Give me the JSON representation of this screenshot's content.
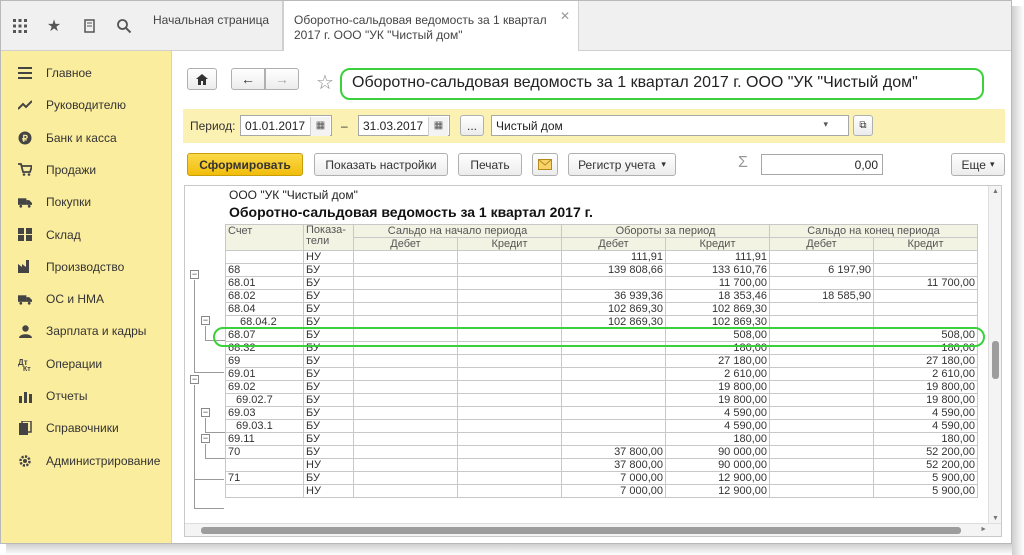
{
  "tabs": [
    {
      "label": "Начальная страница"
    },
    {
      "label": "Оборотно-сальдовая ведомость за 1 квартал 2017 г. ООО \"УК \"Чистый дом\""
    }
  ],
  "sidebar": {
    "items": [
      {
        "label": "Главное",
        "icon": "menu-icon"
      },
      {
        "label": "Руководителю",
        "icon": "trend-icon"
      },
      {
        "label": "Банк и касса",
        "icon": "coin-icon"
      },
      {
        "label": "Продажи",
        "icon": "cart-icon"
      },
      {
        "label": "Покупки",
        "icon": "truck-icon"
      },
      {
        "label": "Склад",
        "icon": "warehouse-icon"
      },
      {
        "label": "Производство",
        "icon": "factory-icon"
      },
      {
        "label": "ОС и НМА",
        "icon": "truck-icon"
      },
      {
        "label": "Зарплата и кадры",
        "icon": "person-icon"
      },
      {
        "label": "Операции",
        "icon": "operations-icon"
      },
      {
        "label": "Отчеты",
        "icon": "chart-icon"
      },
      {
        "label": "Справочники",
        "icon": "books-icon"
      },
      {
        "label": "Администрирование",
        "icon": "gear-icon"
      }
    ]
  },
  "header": {
    "title": "Оборотно-сальдовая ведомость за 1 квартал 2017 г. ООО \"УК \"Чистый дом\""
  },
  "period": {
    "label": "Период:",
    "from": "01.01.2017",
    "dash": "–",
    "to": "31.03.2017",
    "ellipsis": "...",
    "org": "Чистый дом"
  },
  "toolbar": {
    "generate": "Сформировать",
    "settings": "Показать настройки",
    "print": "Печать",
    "register": "Регистр учета",
    "sum_symbol": "Σ",
    "sum_value": "0,00",
    "more": "Еще"
  },
  "report": {
    "company": "ООО \"УК \"Чистый дом\"",
    "title": "Оборотно-сальдовая ведомость за 1 квартал 2017 г.",
    "headers": {
      "account": "Счет",
      "indicator_line1": "Показа-",
      "indicator_line2": "тели",
      "opening": "Сальдо на начало периода",
      "turnover": "Обороты за период",
      "closing": "Сальдо на конец периода",
      "debit": "Дебет",
      "credit": "Кредит"
    },
    "rows": [
      {
        "account": "",
        "ind": "НУ",
        "od": "",
        "oc": "",
        "td": "111,91",
        "tc": "111,91",
        "cd": "",
        "cc": ""
      },
      {
        "account": "68",
        "ind": "БУ",
        "od": "",
        "oc": "",
        "td": "139 808,66",
        "tc": "133 610,76",
        "cd": "6 197,90",
        "cc": ""
      },
      {
        "account": "68.01",
        "ind": "БУ",
        "od": "",
        "oc": "",
        "td": "",
        "tc": "11 700,00",
        "cd": "",
        "cc": "11 700,00"
      },
      {
        "account": "68.02",
        "ind": "БУ",
        "od": "",
        "oc": "",
        "td": "36 939,36",
        "tc": "18 353,46",
        "cd": "18 585,90",
        "cc": ""
      },
      {
        "account": "68.04",
        "ind": "БУ",
        "od": "",
        "oc": "",
        "td": "102 869,30",
        "tc": "102 869,30",
        "cd": "",
        "cc": ""
      },
      {
        "account": "68.04.2",
        "ind": "БУ",
        "od": "",
        "oc": "",
        "td": "102 869,30",
        "tc": "102 869,30",
        "cd": "",
        "cc": ""
      },
      {
        "account": "68.07",
        "ind": "БУ",
        "od": "",
        "oc": "",
        "td": "",
        "tc": "508,00",
        "cd": "",
        "cc": "508,00"
      },
      {
        "account": "68.32",
        "ind": "БУ",
        "od": "",
        "oc": "",
        "td": "",
        "tc": "180,00",
        "cd": "",
        "cc": "180,00"
      },
      {
        "account": "69",
        "ind": "БУ",
        "od": "",
        "oc": "",
        "td": "",
        "tc": "27 180,00",
        "cd": "",
        "cc": "27 180,00"
      },
      {
        "account": "69.01",
        "ind": "БУ",
        "od": "",
        "oc": "",
        "td": "",
        "tc": "2 610,00",
        "cd": "",
        "cc": "2 610,00"
      },
      {
        "account": "69.02",
        "ind": "БУ",
        "od": "",
        "oc": "",
        "td": "",
        "tc": "19 800,00",
        "cd": "",
        "cc": "19 800,00"
      },
      {
        "account": "69.02.7",
        "ind": "БУ",
        "od": "",
        "oc": "",
        "td": "",
        "tc": "19 800,00",
        "cd": "",
        "cc": "19 800,00"
      },
      {
        "account": "69.03",
        "ind": "БУ",
        "od": "",
        "oc": "",
        "td": "",
        "tc": "4 590,00",
        "cd": "",
        "cc": "4 590,00"
      },
      {
        "account": "69.03.1",
        "ind": "БУ",
        "od": "",
        "oc": "",
        "td": "",
        "tc": "4 590,00",
        "cd": "",
        "cc": "4 590,00"
      },
      {
        "account": "69.11",
        "ind": "БУ",
        "od": "",
        "oc": "",
        "td": "",
        "tc": "180,00",
        "cd": "",
        "cc": "180,00"
      },
      {
        "account": "70",
        "ind": "БУ",
        "od": "",
        "oc": "",
        "td": "37 800,00",
        "tc": "90 000,00",
        "cd": "",
        "cc": "52 200,00"
      },
      {
        "account": "",
        "ind": "НУ",
        "od": "",
        "oc": "",
        "td": "37 800,00",
        "tc": "90 000,00",
        "cd": "",
        "cc": "52 200,00"
      },
      {
        "account": "71",
        "ind": "БУ",
        "od": "",
        "oc": "",
        "td": "7 000,00",
        "tc": "12 900,00",
        "cd": "",
        "cc": "5 900,00"
      },
      {
        "account": "",
        "ind": "НУ",
        "od": "",
        "oc": "",
        "td": "7 000,00",
        "tc": "12 900,00",
        "cd": "",
        "cc": "5 900,00"
      }
    ]
  },
  "colors": {
    "sidebar_bg": "#fbed9e",
    "generate_btn": "#f5c81e",
    "highlight": "#3cd03c"
  }
}
